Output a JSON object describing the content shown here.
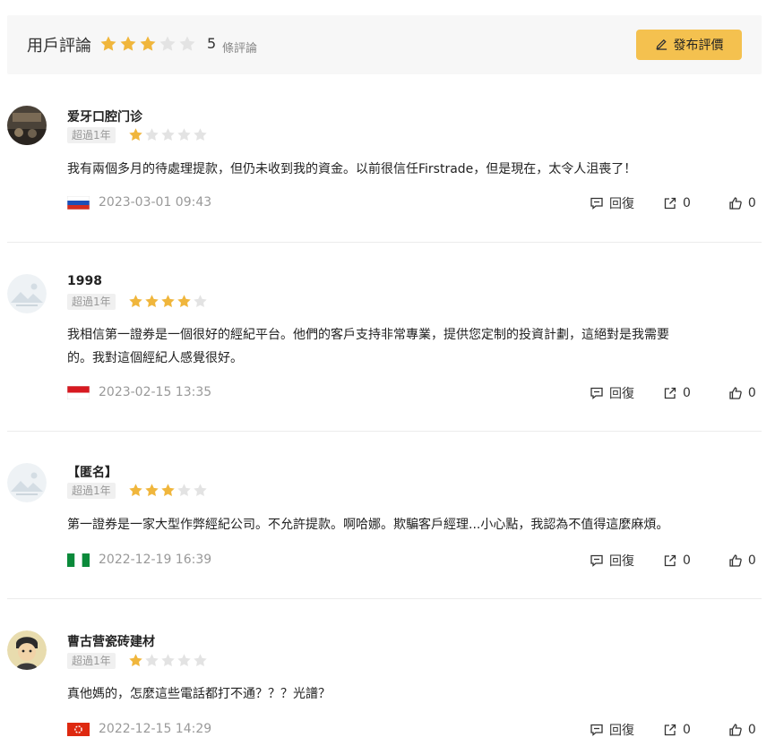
{
  "header": {
    "title": "用戶評論",
    "rating": 3,
    "count": "5",
    "count_unit": "條評論",
    "publish_label": "發布評價"
  },
  "colors": {
    "star_on": "#f0b63c",
    "star_off": "#e3e3e3",
    "button": "#f4c14f"
  },
  "reviews": [
    {
      "name": "爱牙口腔门诊",
      "tenure": "超過1年",
      "rating": 1,
      "text": [
        "我有兩個多月的待處理提款，但仍未收到我的資金。以前很信任Firstrade，但是現在，太令人沮喪了！"
      ],
      "flag": "russia",
      "date": "2023-03-01 09:43",
      "reply_label": "回復",
      "shares": "0",
      "likes": "0"
    },
    {
      "name": "1998",
      "tenure": "超過1年",
      "rating": 4,
      "text": [
        "我相信第一證券是一個很好的經紀平台。他們的客戶支持非常專業，提供您定制的投資計劃，這絕對是我需要",
        "的。我對這個經紀人感覺很好。"
      ],
      "flag": "indonesia",
      "date": "2023-02-15 13:35",
      "reply_label": "回復",
      "shares": "0",
      "likes": "0"
    },
    {
      "name": "【匿名】",
      "tenure": "超過1年",
      "rating": 3,
      "text": [
        "第一證券是一家大型作弊經紀公司。不允許提款。啊哈娜。欺騙客戶經理...小心點，我認為不值得這麼麻煩。"
      ],
      "flag": "nigeria",
      "date": "2022-12-19 16:39",
      "reply_label": "回復",
      "shares": "0",
      "likes": "0"
    },
    {
      "name": "曹古营瓷砖建材",
      "tenure": "超過1年",
      "rating": 1,
      "text": [
        "真他媽的，怎麼這些電話都打不通？？？光譜？"
      ],
      "flag": "hongkong",
      "date": "2022-12-15 14:29",
      "reply_label": "回復",
      "shares": "0",
      "likes": "0"
    }
  ]
}
